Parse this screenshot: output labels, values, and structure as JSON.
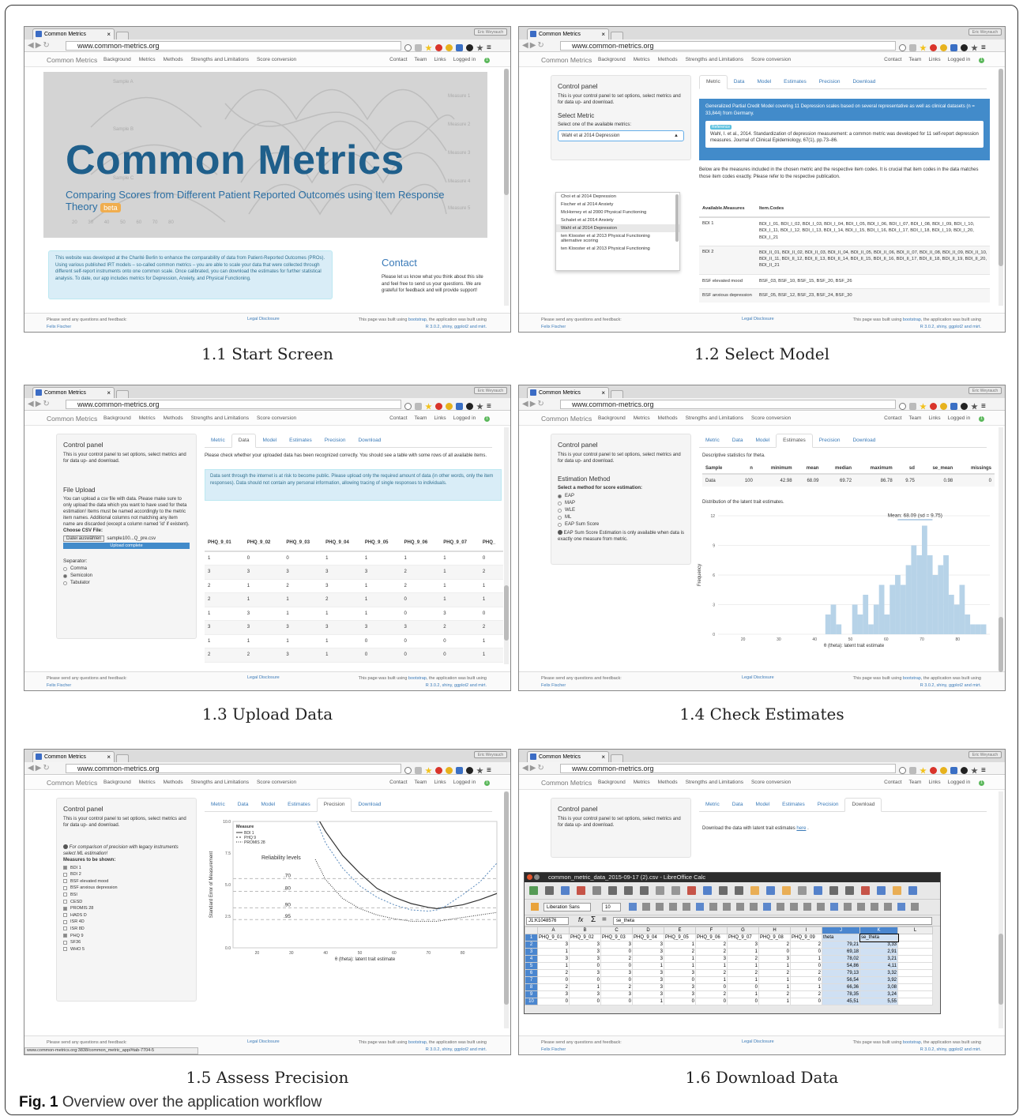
{
  "figure": {
    "caption_label": "Fig. 1",
    "caption_text": "Overview over the application workflow"
  },
  "browser": {
    "tab_title": "Common Metrics",
    "tab_close": "×",
    "url": "www.common-metrics.org",
    "window_button": "Eric Weyrauch"
  },
  "nav": {
    "brand": "Common Metrics",
    "left_items": [
      "Background",
      "Metrics",
      "Methods",
      "Strengths and Limitations",
      "Score conversion"
    ],
    "right_items": [
      "Contact",
      "Team",
      "Links",
      "Logged in"
    ],
    "logged_badge": "1"
  },
  "footer": {
    "left_line1": "Please send any questions and feedback:",
    "left_line2": "Felix Fischer",
    "center": "Legal Disclosure",
    "right_pre": "This page was built using ",
    "right_link": "bootstrap",
    "right_post": ", the application was built using",
    "right_line2": "R 3.0.2, shiny, ggplot2 and mirt."
  },
  "control_panel": {
    "title": "Control panel",
    "text": "This is your control panel to set options, select metrics and for data up- and download."
  },
  "tabs": [
    "Metric",
    "Data",
    "Model",
    "Estimates",
    "Precision",
    "Download"
  ],
  "screen1": {
    "caption": "1.1 Start Screen",
    "hero_title": "Common Metrics",
    "hero_subtitle": "Comparing Scores from Different Patient Reported Outcomes using Item Response Theory",
    "beta": "beta",
    "samples": [
      "Sample A",
      "Sample B",
      "Sample C"
    ],
    "measures": [
      "Measure 1",
      "Measure 2",
      "Measure 3",
      "Measure 4",
      "Measure 5"
    ],
    "axis_ticks": [
      "20",
      "30",
      "40",
      "50",
      "60",
      "70",
      "80"
    ],
    "info_text": "This website was developed at the Charité Berlin to enhance the comparability of data from Patient-Reported Outcomes (PROs). Using various published IRT models – so-called common metrics – you are able to scale your data that were collected through different self-report instruments onto one common scale. Once calibrated, you can download the estimates for further statistical analysis. To date, our app includes metrics for Depression, Anxiety, and Physical Functioning.",
    "contact_title": "Contact",
    "contact_text": "Please let us know what you think about this site and feel free to send us your questions. We are grateful for feedback and will provide support!"
  },
  "screen2": {
    "caption": "1.2 Select Model",
    "select_metric": "Select Metric",
    "select_label": "Select one of the available metrics:",
    "selected": "Wahl et al 2014 Depression",
    "options": [
      "Choi et al 2014 Depression",
      "Fischer et al 2014 Anxiety",
      "McHorney et al 2000 Physical Functioning",
      "Schalet et al 2014 Anxiety",
      "Wahl et al 2014 Depression",
      "ten Klooster et al 2013 Physical Functioning alternative scoring",
      "ten Klooster et al 2013 Physical Functioning"
    ],
    "model_desc": "Generalized Partial Credit Model covering 11 Depression scales based on several representative as well as clinical datasets (n = 33,844) from Germany.",
    "ref_badge": "Reference",
    "reference": "Wahl, I. et al., 2014. Standardization of depression measurement: a common metric was developed for 11 self-report depression measures. Journal of Clinical Epidemiology, 67(1), pp.73–86.",
    "below_text": "Below are the measures included in the chosen metric and the respective item codes. It is crucial that item codes in the data matches those item codes exactly. Please refer to the respective publication.",
    "col_headers": [
      "Available.Measures",
      "Item.Codes"
    ],
    "rows": [
      [
        "BDI 1",
        "BDI_I_01, BDI_I_02, BDI_I_03, BDI_I_04, BDI_I_05, BDI_I_06, BDI_I_07, BDI_I_08, BDI_I_09, BDI_I_10, BDI_I_11, BDI_I_12, BDI_I_13, BDI_I_14, BDI_I_15, BDI_I_16, BDI_I_17, BDI_I_18, BDI_I_19, BDI_I_20, BDI_I_21"
      ],
      [
        "BDI 2",
        "BDI_II_01, BDI_II_02, BDI_II_03, BDI_II_04, BDI_II_05, BDI_II_06, BDI_II_07, BDI_II_08, BDI_II_09, BDI_II_10, BDI_II_11, BDI_II_12, BDI_II_13, BDI_II_14, BDI_II_15, BDI_II_16, BDI_II_17, BDI_II_18, BDI_II_19, BDI_II_20, BDI_II_21"
      ],
      [
        "BSF elevated mood",
        "BSF_03, BSF_10, BSF_15, BSF_20, BSF_26"
      ],
      [
        "BSF anxious depression",
        "BSF_05, BSF_12, BSF_23, BSF_24, BSF_30"
      ]
    ]
  },
  "screen3": {
    "caption": "1.3 Upload Data",
    "file_upload": "File Upload",
    "upload_text": "You can upload a csv file with data. Please make sure to only upload the data which you want to have used for theta estimation! Items must be named accordingly to the metric item names. Additional columns not matching any item name are discarded (except a column named 'id' if existent).",
    "choose_label": "Choose CSV File:",
    "browse_button": "Datei auswählen",
    "file_name": "sample100...Q_pre.csv",
    "upload_complete": "Upload complete",
    "separator_label": "Separator:",
    "separators": [
      "Comma",
      "Semicolon",
      "Tabulator"
    ],
    "check_text": "Please check whether your uploaded data has been recognized correctly. You should see a table with some rows of all available items.",
    "warning": "Data sent through the internet is at risk to become public. Please upload only the required amount of data (in other words, only the item responses). Data should not contain any personal information, allowing tracing of single responses to individuals.",
    "headers": [
      "PHQ_9_01",
      "PHQ_9_02",
      "PHQ_9_03",
      "PHQ_9_04",
      "PHQ_9_05",
      "PHQ_9_06",
      "PHQ_9_07",
      "PHQ_"
    ],
    "rows": [
      [
        "1",
        "0",
        "0",
        "1",
        "1",
        "1",
        "1",
        "0"
      ],
      [
        "3",
        "3",
        "3",
        "3",
        "3",
        "2",
        "1",
        "2"
      ],
      [
        "2",
        "1",
        "2",
        "3",
        "1",
        "2",
        "1",
        "1"
      ],
      [
        "2",
        "1",
        "1",
        "2",
        "1",
        "0",
        "1",
        "1"
      ],
      [
        "1",
        "3",
        "1",
        "1",
        "1",
        "0",
        "3",
        "0"
      ],
      [
        "3",
        "3",
        "3",
        "3",
        "3",
        "3",
        "2",
        "2"
      ],
      [
        "1",
        "1",
        "1",
        "1",
        "0",
        "0",
        "0",
        "1"
      ],
      [
        "2",
        "2",
        "3",
        "1",
        "0",
        "0",
        "0",
        "1"
      ]
    ]
  },
  "screen4": {
    "caption": "1.4 Check Estimates",
    "method_title": "Estimation Method",
    "method_label": "Select a method for score estimation:",
    "methods": [
      "EAP",
      "MAP",
      "WLE",
      "ML",
      "EAP Sum Score"
    ],
    "sum_note": "EAP Sum Score Estimation is only available when data is exactly one measure from metric.",
    "desc_label": "Descriptive statistics for theta.",
    "stat_headers": [
      "Sample",
      "n",
      "minimum",
      "mean",
      "median",
      "maximum",
      "sd",
      "se_mean",
      "missings"
    ],
    "stat_row": [
      "Data",
      "100",
      "42.98",
      "68.09",
      "69.72",
      "86.78",
      "9.75",
      "0.98",
      "0"
    ],
    "dist_label": "Distribution of the latent trait estimates.",
    "mean_label": "Mean: 68.09 (sd = 9.75)",
    "ylabel": "Frequency",
    "xlabel": "θ (theta): latent trait estimate",
    "y_ticks": [
      "0",
      "3",
      "6",
      "9",
      "12"
    ],
    "x_ticks": [
      "20",
      "30",
      "40",
      "50",
      "60",
      "70",
      "80"
    ]
  },
  "screen5": {
    "caption": "1.5 Assess Precision",
    "note": "For comparison of precision with legacy instruments select ML estimation!",
    "measures_label": "Measures to be shown:",
    "measures": [
      "BDI 1",
      "BDI 2",
      "BSF elevated mood",
      "BSF anxious depression",
      "BSI",
      "CESD",
      "PROMIS 28",
      "HADS D",
      "ISR 4D",
      "ISR 8D",
      "PHQ 9",
      "SF36",
      "WHO 5"
    ],
    "checked": [
      true,
      false,
      false,
      false,
      false,
      false,
      true,
      false,
      false,
      false,
      true,
      false,
      false
    ],
    "legend_title": "Measure",
    "legend_items": [
      "BDI 1",
      "PHQ 9",
      "PROMIS 28"
    ],
    "reliability_title": "Reliability levels",
    "reliability": [
      ".70",
      ".80",
      ".90",
      ".95"
    ],
    "ylabel": "Standard Error of Measurement",
    "xlabel": "θ (theta): latent trait estimate",
    "y_ticks": [
      "0.0",
      "2.5",
      "5.0",
      "7.5",
      "10.0"
    ],
    "x_ticks": [
      "20",
      "30",
      "40",
      "50",
      "60",
      "70",
      "80"
    ],
    "status_url": "www.common-metrics.org:3838/common_metric_app/#tab-7704-5"
  },
  "screen6": {
    "caption": "1.6 Download Data",
    "download_text_pre": "Download the data with latent trait estimates ",
    "download_link": "here",
    "calc_title": "common_metric_data_2015-09-17 (2).csv - LibreOffice Calc",
    "font_name": "Liberation Sans",
    "font_size": "10",
    "cell_ref": "J1:K1048576",
    "formula": "se_theta",
    "col_letters": [
      "A",
      "B",
      "C",
      "D",
      "E",
      "F",
      "G",
      "H",
      "I",
      "J",
      "K",
      "L"
    ],
    "headers": [
      "PHQ_9_01",
      "PHQ_9_02",
      "PHQ_9_03",
      "PHQ_9_04",
      "PHQ_9_05",
      "PHQ_9_06",
      "PHQ_9_07",
      "PHQ_9_08",
      "PHQ_9_09",
      "theta",
      "se_theta"
    ],
    "rows": [
      [
        "3",
        "3",
        "3",
        "3",
        "1",
        "2",
        "3",
        "2",
        "2",
        "79,21",
        "3,33"
      ],
      [
        "1",
        "3",
        "0",
        "3",
        "2",
        "2",
        "1",
        "0",
        "0",
        "69,18",
        "2,91"
      ],
      [
        "3",
        "3",
        "2",
        "3",
        "1",
        "3",
        "2",
        "3",
        "1",
        "78,02",
        "3,21"
      ],
      [
        "1",
        "0",
        "0",
        "1",
        "1",
        "1",
        "1",
        "1",
        "0",
        "54,86",
        "4,11"
      ],
      [
        "2",
        "3",
        "3",
        "3",
        "3",
        "2",
        "2",
        "2",
        "2",
        "79,13",
        "3,32"
      ],
      [
        "0",
        "0",
        "0",
        "3",
        "0",
        "1",
        "1",
        "1",
        "0",
        "56,54",
        "3,92"
      ],
      [
        "2",
        "1",
        "2",
        "3",
        "3",
        "0",
        "0",
        "1",
        "1",
        "66,36",
        "3,08"
      ],
      [
        "3",
        "3",
        "3",
        "3",
        "3",
        "2",
        "1",
        "2",
        "2",
        "78,35",
        "3,24"
      ],
      [
        "0",
        "0",
        "0",
        "1",
        "0",
        "0",
        "0",
        "1",
        "0",
        "45,51",
        "5,55"
      ]
    ]
  },
  "chart_data": [
    {
      "type": "bar",
      "ylabel": "Frequency",
      "xlabel": "θ (theta): latent trait estimate",
      "title": "",
      "annotation": "Mean: 68.09 (sd = 9.75)",
      "xlim": [
        13,
        89
      ],
      "ylim": [
        0,
        12
      ],
      "bin_width": 1.5,
      "bin_starts": [
        43,
        44.5,
        46,
        47.5,
        49,
        50.5,
        52,
        53.5,
        55,
        56.5,
        58,
        59.5,
        61,
        62.5,
        64,
        65.5,
        67,
        68.5,
        70,
        71.5,
        73,
        74.5,
        76,
        77.5,
        79,
        80.5,
        82,
        83.5,
        85,
        86.5
      ],
      "values": [
        2,
        3,
        1,
        0,
        0,
        3,
        2,
        4,
        1,
        3,
        5,
        2,
        5,
        6,
        5,
        7,
        9,
        8,
        11,
        8,
        6,
        7,
        8,
        4,
        3,
        5,
        2,
        1,
        1,
        1
      ]
    },
    {
      "type": "line",
      "ylabel": "Standard Error of Measurement",
      "xlabel": "θ (theta): latent trait estimate",
      "title": "",
      "xlim": [
        13,
        90
      ],
      "ylim": [
        0,
        10
      ],
      "x": [
        37,
        40,
        45,
        50,
        55,
        60,
        65,
        70,
        72.5,
        75,
        80,
        85,
        90
      ],
      "series": [
        {
          "name": "BDI 1",
          "values": [
            10.6,
            9.2,
            7.3,
            5.9,
            4.7,
            4.0,
            3.5,
            3.2,
            3.1,
            3.2,
            3.4,
            3.8,
            4.3
          ]
        },
        {
          "name": "PHQ 9",
          "values": [
            10.3,
            8.3,
            6.3,
            4.9,
            4.0,
            3.4,
            3.0,
            2.9,
            3.0,
            3.3,
            4.2,
            5.2,
            6.7
          ]
        },
        {
          "name": "PROMIS 28",
          "values": [
            7.0,
            5.4,
            3.9,
            3.1,
            2.6,
            2.3,
            2.1,
            2.1,
            2.1,
            2.2,
            2.4,
            2.6,
            2.8
          ]
        }
      ],
      "reference_lines": [
        ".70",
        ".80",
        ".90",
        ".95"
      ]
    }
  ]
}
